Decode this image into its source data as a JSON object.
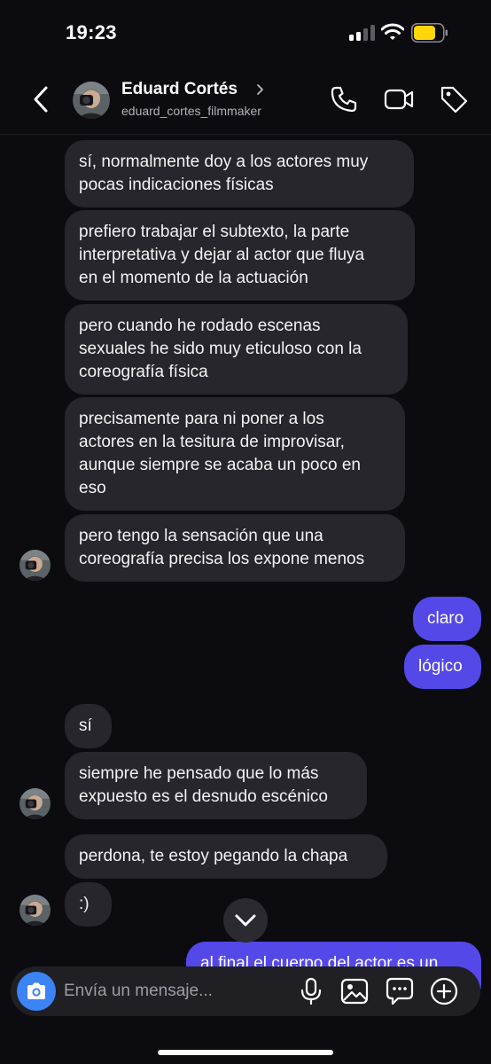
{
  "status_bar": {
    "time": "19:23",
    "signal_icon": "cellular-signal-icon",
    "wifi_icon": "wifi-icon",
    "battery_icon": "battery-low-power-icon",
    "battery_color": "#ffd60a",
    "battery_level": 0.75
  },
  "header": {
    "back_icon": "chevron-left-icon",
    "contact_name": "Eduard Cortés",
    "contact_handle": "eduard_cortes_filmmaker",
    "name_chevron_icon": "chevron-right-icon",
    "actions": [
      "phone-icon",
      "video-camera-icon",
      "tag-icon"
    ]
  },
  "messages": [
    {
      "direction": "in",
      "text": "sí, normalmente doy a los actores muy\npocas indicaciones físicas"
    },
    {
      "direction": "in",
      "text": "prefiero trabajar el subtexto, la parte\ninterpretativa y dejar al actor que fluya\nen el momento de la actuación"
    },
    {
      "direction": "in",
      "text": "pero cuando he rodado escenas\nsexuales he sido muy eticuloso con la\ncoreografía física"
    },
    {
      "direction": "in",
      "text": "precisamente para ni poner a los\nactores en la tesitura de improvisar,\naunque siempre se acaba un poco en\neso"
    },
    {
      "direction": "in",
      "text": "pero tengo la sensación que una\ncoreografía precisa los expone menos"
    },
    {
      "direction": "out",
      "text": "claro"
    },
    {
      "direction": "out",
      "text": "lógico"
    },
    {
      "direction": "in",
      "text": "sí"
    },
    {
      "direction": "in",
      "text": "siempre he pensado que lo más\nexpuesto es el desnudo escénico"
    },
    {
      "direction": "in",
      "text": "perdona, te estoy pegando la chapa"
    },
    {
      "direction": "in",
      "text": ":)"
    },
    {
      "direction": "out",
      "text": "al final el cuerpo del actor es un"
    }
  ],
  "scroll_down_icon": "chevron-down-icon",
  "composer": {
    "camera_icon": "camera-icon",
    "placeholder": "Envía un mensaje...",
    "value": "",
    "icons": [
      "microphone-icon",
      "image-icon",
      "sticker-icon",
      "plus-icon"
    ]
  },
  "colors": {
    "background": "#0b0b10",
    "incoming_bubble": "#26262c",
    "outgoing_bubble": "#5548e8",
    "camera_button": "#3c83f6"
  }
}
